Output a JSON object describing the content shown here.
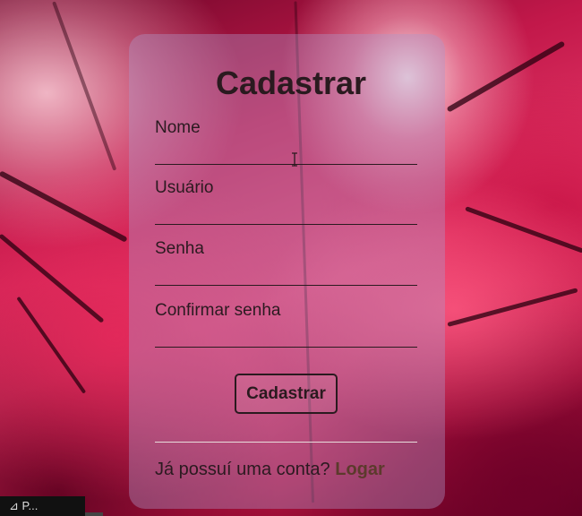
{
  "form": {
    "title": "Cadastrar",
    "fields": [
      {
        "label": "Nome",
        "value": "",
        "placeholder": ""
      },
      {
        "label": "Usuário",
        "value": "",
        "placeholder": ""
      },
      {
        "label": "Senha",
        "value": "",
        "placeholder": ""
      },
      {
        "label": "Confirmar senha",
        "value": "",
        "placeholder": ""
      }
    ],
    "submit_label": "Cadastrar",
    "footer_text": "Já possuí uma conta?",
    "footer_link": "Logar"
  },
  "taskbar": {
    "label": "⊿ P..."
  },
  "colors": {
    "card_bg": "rgba(175,150,200,0.40)",
    "text": "#2a1a1f",
    "link": "#5c3a2c",
    "background_primary": "#c2184a"
  },
  "icons": {
    "cursor": "text-cursor-icon"
  }
}
